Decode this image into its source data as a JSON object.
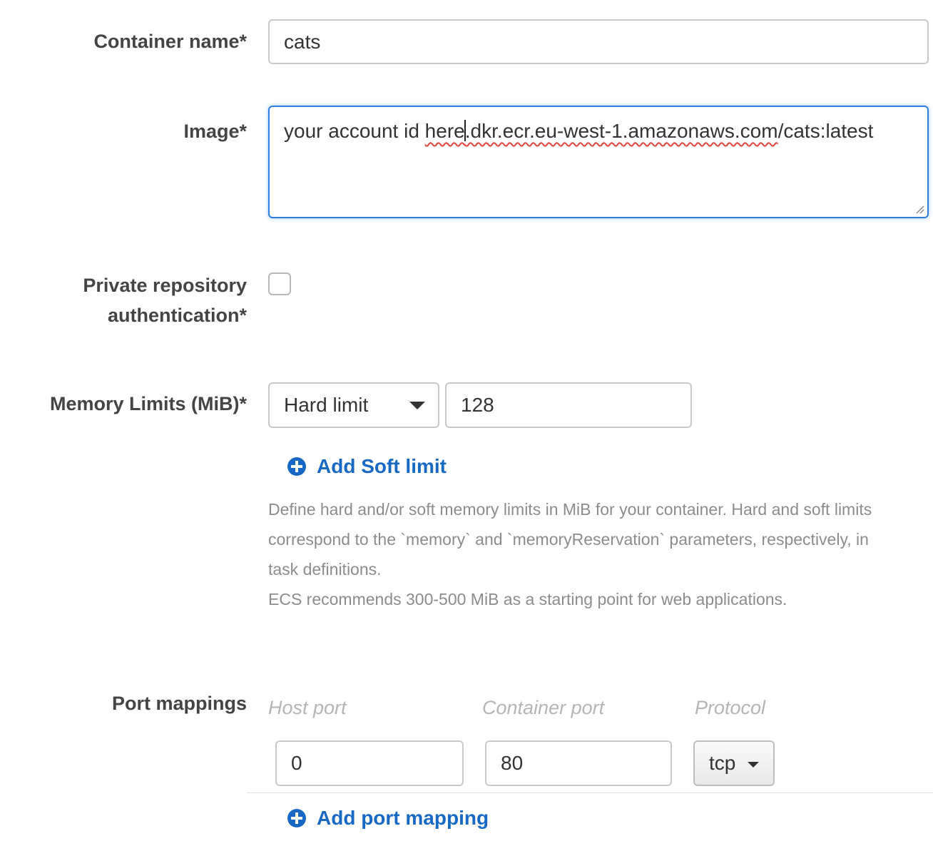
{
  "container_name": {
    "label": "Container name*",
    "value": "cats"
  },
  "image": {
    "label": "Image*",
    "value_part1": "your account id ",
    "value_part2": "here",
    "value_part3": ".dkr.ecr.eu-west-1.amazonaws.com",
    "value_part4": "/cats:latest"
  },
  "private_repo": {
    "label_line1": "Private repository",
    "label_line2": "authentication*",
    "checked": false
  },
  "memory": {
    "label": "Memory Limits (MiB)*",
    "limit_type": "Hard limit",
    "limit_value": "128",
    "add_soft_limit": "Add Soft limit",
    "help_line1": "Define hard and/or soft memory limits in MiB for your container. Hard and soft limits",
    "help_line2": "correspond to the `memory` and `memoryReservation` parameters, respectively, in",
    "help_line3": "task definitions.",
    "help_line4": "ECS recommends 300-500 MiB as a starting point for web applications."
  },
  "ports": {
    "label": "Port mappings",
    "host_port_header": "Host port",
    "container_port_header": "Container port",
    "protocol_header": "Protocol",
    "host_port": "0",
    "container_port": "80",
    "protocol": "tcp",
    "add_port_mapping": "Add port mapping"
  },
  "colors": {
    "link": "#1769c4",
    "focus": "#2f7fe0",
    "spellcheck": "#e0463c"
  }
}
